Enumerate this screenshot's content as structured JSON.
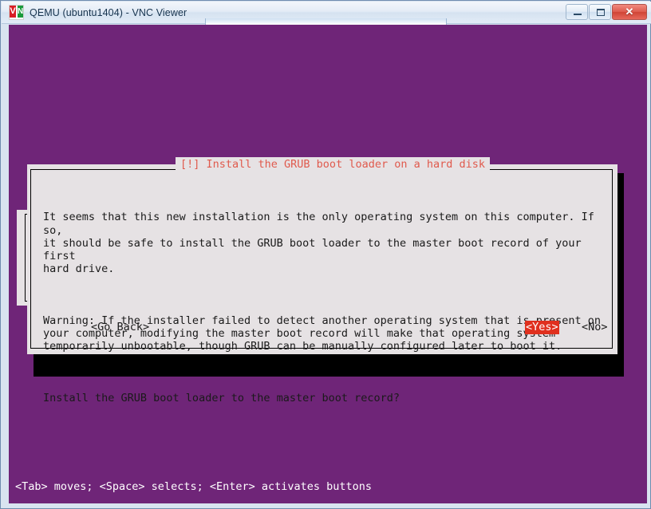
{
  "window": {
    "title": "QEMU (ubuntu1404) - VNC Viewer",
    "logo_v": "V",
    "logo_n": "N",
    "controls": {
      "minimize_label": "─",
      "maximize_label": "▭",
      "close_label": "✕"
    }
  },
  "colors": {
    "desktop_purple": "#6f2578",
    "dialog_background": "#e6e2e4",
    "dialog_title_text": "#e05a4d",
    "selected_button_background": "#e0301e",
    "selected_button_text": "#ffffff",
    "titlebar_text": "#16334e"
  },
  "dialog": {
    "title": "[!] Install the GRUB boot loader on a hard disk",
    "paragraphs": [
      "It seems that this new installation is the only operating system on this computer. If so,\nit should be safe to install the GRUB boot loader to the master boot record of your first\nhard drive.",
      "Warning: If the installer failed to detect another operating system that is present on\nyour computer, modifying the master boot record will make that operating system\ntemporarily unbootable, though GRUB can be manually configured later to boot it.",
      "Install the GRUB boot loader to the master boot record?"
    ],
    "buttons": {
      "go_back": "<Go Back>",
      "yes": "<Yes>",
      "no": "<No>",
      "selected": "<Yes>"
    }
  },
  "statusbar": {
    "hint": "<Tab> moves; <Space> selects; <Enter> activates buttons"
  }
}
